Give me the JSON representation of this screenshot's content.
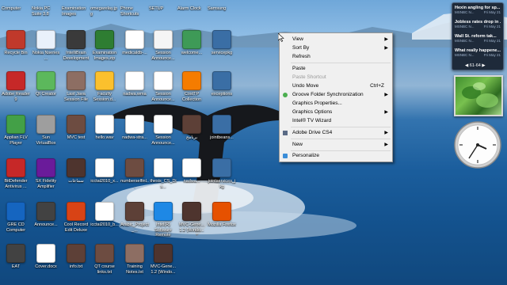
{
  "desktop": {
    "icons_top_cut": [
      "Computer",
      "Nokia PC Suite 3.8",
      "Examination Images",
      "omegarelay.jpg",
      "Phone Shortcuts",
      "SETUP",
      "Alarm Clock",
      "Samsung"
    ],
    "icons": [
      {
        "label": "Recycle Bin",
        "icon": "recycle-bin-icon",
        "color": "#c0392b"
      },
      {
        "label": "Nokia Nseries ...",
        "icon": "nokia-icon",
        "color": "#e9f1fb"
      },
      {
        "label": "IntelliBrain Development",
        "icon": "book-icon",
        "color": "#3a3a3a"
      },
      {
        "label": "Examination Images.zip",
        "icon": "zip-icon",
        "color": "#2e7d32"
      },
      {
        "label": "medicaldb-...",
        "icon": "document-icon",
        "color": "#ffffff"
      },
      {
        "label": "Session Announce...",
        "icon": "document-icon",
        "color": "#f5f5f5"
      },
      {
        "label": "welcome...",
        "icon": "video-icon",
        "color": "#3e9a57"
      },
      {
        "label": "servicepkg",
        "icon": "folder-icon",
        "color": "#3a6ea5"
      },
      {
        "label": "Adobe Reader 9",
        "icon": "adobe-reader-icon",
        "color": "#c62828"
      },
      {
        "label": "Qt Creator",
        "icon": "qt-creator-icon",
        "color": "#5cb85c"
      },
      {
        "label": "Last Java Session File",
        "icon": "book-icon",
        "color": "#8d6e63"
      },
      {
        "label": "Faculty Session.d...",
        "icon": "zip-icon",
        "color": "#fbc02d"
      },
      {
        "label": "nadwa.wma",
        "icon": "audio-file-icon",
        "color": "#ffffff"
      },
      {
        "label": "Session Announce...",
        "icon": "document-icon",
        "color": "#ffffff"
      },
      {
        "label": "CostTP Collection",
        "icon": "flower-icon",
        "color": "#f57c00"
      },
      {
        "label": "exceptions",
        "icon": "folder-icon",
        "color": "#3a6ea5"
      },
      {
        "label": "Applian FLV Player",
        "icon": "flv-player-icon",
        "color": "#43a047"
      },
      {
        "label": "Sun VirtualBox",
        "icon": "virtualbox-icon",
        "color": "#9e9e9e"
      },
      {
        "label": "MVC test",
        "icon": "book-icon",
        "color": "#6d4c41"
      },
      {
        "label": "hello.wav",
        "icon": "audio-file-icon",
        "color": "#ffffff"
      },
      {
        "label": "nadwa-stra...",
        "icon": "audio-file-icon",
        "color": "#ffffff"
      },
      {
        "label": "Session Announce...",
        "icon": "document-icon",
        "color": "#ffffff"
      },
      {
        "label": "برنامج",
        "icon": "book-icon",
        "color": "#5d4037"
      },
      {
        "label": "jointbeans...",
        "icon": "folder-icon",
        "color": "#3a6ea5"
      },
      {
        "label": "BitDefender Antivirus ...",
        "icon": "bitdefender-icon",
        "color": "#c62828"
      },
      {
        "label": "SX Fidelity Amplifier",
        "icon": "sx-fidelity-icon",
        "color": "#6a1b9a"
      },
      {
        "label": "سماعات",
        "icon": "book-icon",
        "color": "#4e342e"
      },
      {
        "label": "icctai2010_x...",
        "icon": "word-doc-icon",
        "color": "#ffffff"
      },
      {
        "label": "numberselfinl...",
        "icon": "book-icon",
        "color": "#6d4c41"
      },
      {
        "label": "thesis_CS_Dis...",
        "icon": "pdf-icon",
        "color": "#ffffff"
      },
      {
        "label": "nadwa...",
        "icon": "audio-file-icon",
        "color": "#ffffff"
      },
      {
        "label": "jointservices_jkg",
        "icon": "folder-icon",
        "color": "#3a6ea5"
      },
      {
        "label": "GRE CD Computer",
        "icon": "kaplan-icon",
        "color": "#1565c0"
      },
      {
        "label": "Announce...",
        "icon": "book-icon",
        "color": "#424242"
      },
      {
        "label": "Cool Record Edit Deluxe",
        "icon": "record-icon",
        "color": "#d84315"
      },
      {
        "label": "icctai2010_b...",
        "icon": "pdf-icon",
        "color": "#ffffff"
      },
      {
        "label": "Arabic_Project_...",
        "icon": "book-icon",
        "color": "#5d4037"
      },
      {
        "label": "Intel(R) Software Remote",
        "icon": "intel-icon",
        "color": "#1e88e5"
      },
      {
        "label": "MVC-Gene... 1.2 (Windo...",
        "icon": "book-icon",
        "color": "#4e342e"
      },
      {
        "label": "Mozilla Firefox",
        "icon": "firefox-icon",
        "color": "#e65100"
      },
      {
        "label": "EAT",
        "icon": "book-icon",
        "color": "#424242"
      },
      {
        "label": "Cover.docx",
        "icon": "word-doc-icon",
        "color": "#ffffff"
      },
      {
        "label": "info.txt",
        "icon": "book-icon",
        "color": "#5d4037"
      },
      {
        "label": "QT course links.txt",
        "icon": "book-icon",
        "color": "#6d4c41"
      },
      {
        "label": "Training Notes.txt",
        "icon": "book-icon",
        "color": "#8d6e63"
      },
      {
        "label": "MVC-Gene... 1.2 (Windo...",
        "icon": "book-icon",
        "color": "#4e342e"
      }
    ]
  },
  "context_menu": {
    "items": [
      {
        "label": "View",
        "submenu": true
      },
      {
        "label": "Sort By",
        "submenu": true
      },
      {
        "label": "Refresh"
      },
      {
        "label": "Paste"
      },
      {
        "label": "Paste Shortcut",
        "disabled": true
      },
      {
        "label": "Undo Move",
        "shortcut": "Ctrl+Z"
      },
      {
        "label": "Groove Folder Synchronization",
        "submenu": true,
        "icon": "groove-icon"
      },
      {
        "label": "Graphics Properties..."
      },
      {
        "label": "Graphics Options",
        "submenu": true
      },
      {
        "label": "Intel® TV Wizard"
      },
      {
        "label": "Adobe Drive CS4",
        "submenu": true,
        "icon": "adobe-drive-icon"
      },
      {
        "label": "New",
        "submenu": true
      },
      {
        "label": "Personalize",
        "icon": "personalize-icon"
      }
    ]
  },
  "gadgets": {
    "news": {
      "items": [
        {
          "title": "Hexin angling for sp...",
          "source": "MSNBC N...",
          "time": "Fri May 21"
        },
        {
          "title": "Jobless rates drop in ...",
          "source": "MSNBC N...",
          "time": "Fri May 21"
        },
        {
          "title": "Wall St. reform tak...",
          "source": "MSNBC N...",
          "time": "Fri May 21"
        },
        {
          "title": "What really happene...",
          "source": "MSNBC N...",
          "time": "Fri May 21"
        }
      ],
      "page": "61-64"
    }
  }
}
